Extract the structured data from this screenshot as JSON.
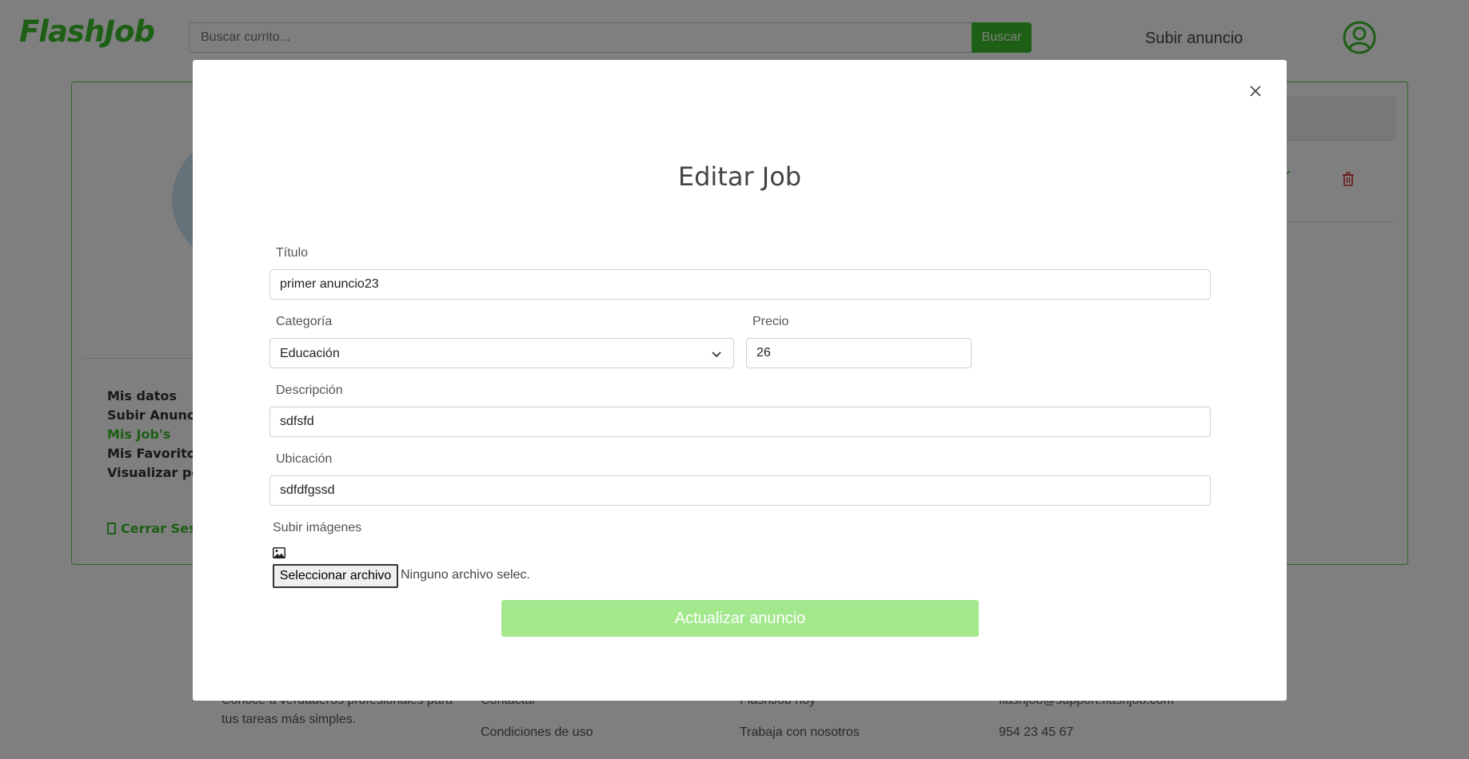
{
  "header": {
    "logo": "FlashJob",
    "search_placeholder": "Buscar currito...",
    "search_button": "Buscar",
    "upload_link": "Subir anuncio"
  },
  "profile_menu": {
    "items": [
      {
        "label": "Mis datos"
      },
      {
        "label": "Subir Anuncio"
      },
      {
        "label": "Mis Job's",
        "active": true
      },
      {
        "label": "Mis Favoritos"
      },
      {
        "label": "Visualizar perf"
      }
    ],
    "logout": "Cerrar Sesi"
  },
  "footer": {
    "tagline_line1": "Conoce a verdaderos profesionales para",
    "tagline_line2": "tus tareas más simples.",
    "col2": [
      "Contactar",
      "Condiciones de uso"
    ],
    "col3": [
      "FlashJob hoy",
      "Trabaja con nosotros"
    ],
    "col4": [
      "flashjob@support.flashjob.com",
      "954 23 45 67"
    ]
  },
  "modal": {
    "title": "Editar Job",
    "titulo_label": "Título",
    "titulo_value": "primer anuncio23",
    "categoria_label": "Categoría",
    "categoria_value": "Educación",
    "precio_label": "Precio",
    "precio_value": "26",
    "descripcion_label": "Descripción",
    "descripcion_value": "sdfsfd",
    "ubicacion_label": "Ubicación",
    "ubicacion_value": "sdfdfgssd",
    "images_label": "Subir imágenes",
    "file_button": "Seleccionar archivo",
    "file_status": "Ninguno archivo selec.",
    "submit": "Actualizar anuncio"
  },
  "colors": {
    "brand_green": "#3bbf2a",
    "submit_disabled": "#a4e88e",
    "delete_red": "#d9343a"
  }
}
